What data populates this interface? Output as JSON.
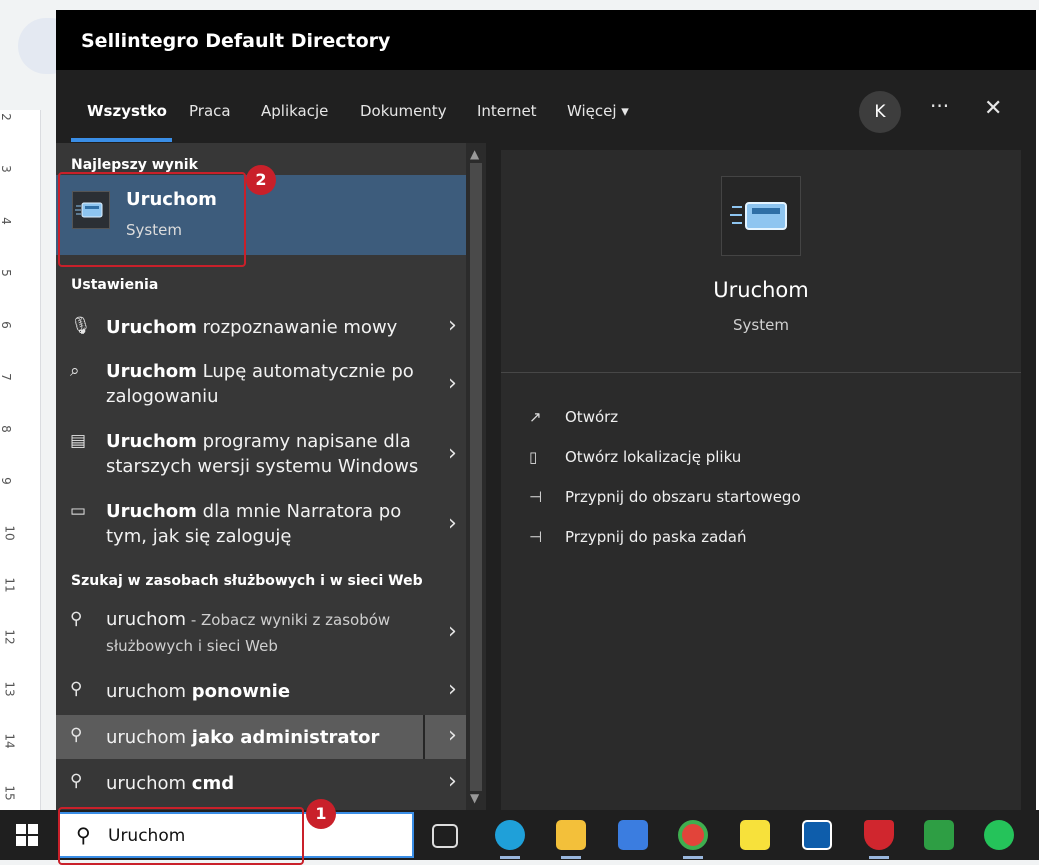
{
  "window": {
    "title": "Sellintegro Default Directory"
  },
  "tabs": {
    "items": [
      {
        "label": "Wszystko"
      },
      {
        "label": "Praca"
      },
      {
        "label": "Aplikacje"
      },
      {
        "label": "Dokumenty"
      },
      {
        "label": "Internet"
      },
      {
        "label": "Więcej ▾"
      }
    ],
    "avatar_initial": "K",
    "more": "···",
    "close": "✕"
  },
  "best": {
    "section": "Najlepszy wynik",
    "name": "Uruchom",
    "sub": "System",
    "badge": "2"
  },
  "settings": {
    "section": "Ustawienia",
    "items": [
      {
        "bold": "Uruchom",
        "rest": " rozpoznawanie mowy"
      },
      {
        "bold": "Uruchom",
        "rest": " Lupę automatycznie po zalogowaniu"
      },
      {
        "bold": "Uruchom",
        "rest": " programy napisane dla starszych wersji systemu Windows"
      },
      {
        "bold": "Uruchom",
        "rest": " dla mnie Narratora po tym, jak się zaloguję"
      }
    ]
  },
  "web": {
    "section": "Szukaj w zasobach służbowych i w sieci Web",
    "items": [
      {
        "term": "uruchom",
        "rest": " - Zobacz wyniki z zasobów służbowych i sieci Web"
      },
      {
        "term": "uruchom ",
        "bold": "ponownie"
      },
      {
        "term": "uruchom ",
        "bold": "jako administrator"
      },
      {
        "term": "uruchom ",
        "bold": "cmd"
      }
    ]
  },
  "preview": {
    "name": "Uruchom",
    "sub": "System",
    "actions": [
      {
        "label": "Otwórz",
        "icon": "open-icon"
      },
      {
        "label": "Otwórz lokalizację pliku",
        "icon": "file-location-icon"
      },
      {
        "label": "Przypnij do obszaru startowego",
        "icon": "pin-icon"
      },
      {
        "label": "Przypnij do paska zadań",
        "icon": "pin-icon"
      }
    ]
  },
  "taskbar": {
    "search_value": "Uruchom",
    "badge": "1"
  },
  "ruler": {
    "numbers": [
      "2",
      "3",
      "4",
      "5",
      "6",
      "7",
      "8",
      "9",
      "10",
      "11",
      "12",
      "13",
      "14",
      "15"
    ]
  },
  "colors": {
    "accent": "#3a8ee6",
    "highlight": "#3d5c7c",
    "marker": "#c9202a"
  }
}
